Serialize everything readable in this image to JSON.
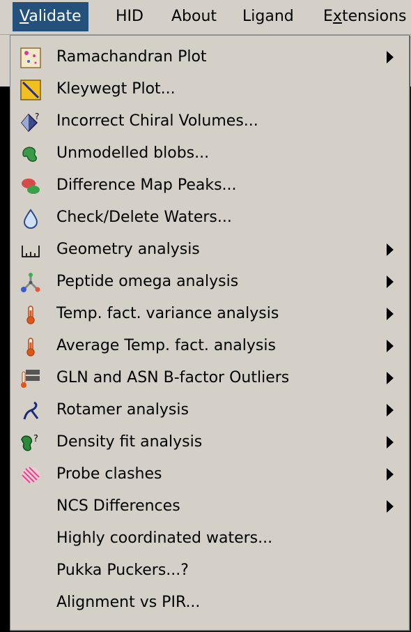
{
  "menubar": {
    "items": [
      {
        "label": "Validate",
        "accel": "V",
        "rest": "alidate"
      },
      {
        "label": "HID"
      },
      {
        "label": "About"
      },
      {
        "label": "Ligand"
      },
      {
        "label": "Extensions",
        "before": "E",
        "accel": "x",
        "rest": "tensions"
      }
    ]
  },
  "menu": {
    "items": [
      {
        "label": "Ramachandran Plot",
        "icon": "ramachandran-plot-icon",
        "submenu": true
      },
      {
        "label": "Kleywegt Plot...",
        "icon": "kleywegt-plot-icon",
        "submenu": false
      },
      {
        "label": "Incorrect Chiral Volumes...",
        "icon": "chiral-volume-icon",
        "submenu": false
      },
      {
        "label": "Unmodelled blobs...",
        "icon": "blob-icon",
        "submenu": false
      },
      {
        "label": "Difference Map Peaks...",
        "icon": "difference-map-icon",
        "submenu": false
      },
      {
        "label": "Check/Delete Waters...",
        "icon": "water-drop-icon",
        "submenu": false
      },
      {
        "label": "Geometry analysis",
        "icon": "ruler-icon",
        "submenu": true
      },
      {
        "label": "Peptide omega analysis",
        "icon": "peptide-icon",
        "submenu": true
      },
      {
        "label": "Temp. fact. variance analysis",
        "icon": "thermometer-icon",
        "submenu": true
      },
      {
        "label": "Average Temp. fact. analysis",
        "icon": "thermometer-icon",
        "submenu": true
      },
      {
        "label": "GLN and ASN B-factor Outliers",
        "icon": "gln-asn-icon",
        "submenu": true
      },
      {
        "label": "Rotamer analysis",
        "icon": "rotamer-icon",
        "submenu": true
      },
      {
        "label": "Density fit analysis",
        "icon": "density-fit-icon",
        "submenu": true
      },
      {
        "label": "Probe clashes",
        "icon": "probe-clash-icon",
        "submenu": true
      },
      {
        "label": "NCS Differences",
        "icon": "",
        "submenu": true
      },
      {
        "label": "Highly coordinated waters...",
        "icon": "",
        "submenu": false
      },
      {
        "label": "Pukka Puckers...?",
        "icon": "",
        "submenu": false
      },
      {
        "label": "Alignment vs PIR...",
        "icon": "",
        "submenu": false
      }
    ]
  },
  "colors": {
    "menu_bg": "#d4d0c8",
    "highlight": "#24517c"
  }
}
